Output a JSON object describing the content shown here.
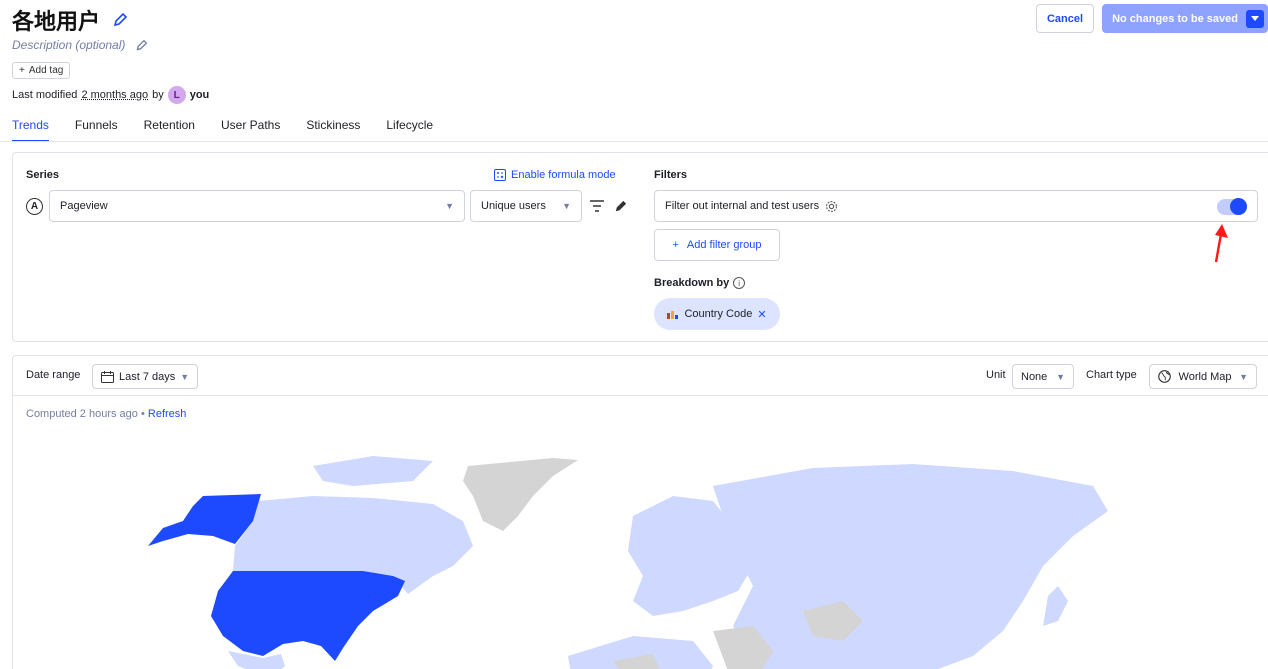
{
  "header": {
    "title": "各地用户",
    "description_placeholder": "Description (optional)",
    "add_tag_label": "Add tag",
    "modified_prefix": "Last modified",
    "modified_ago": "2 months ago",
    "modified_by": "by",
    "avatar_letter": "L",
    "author": "you"
  },
  "actions": {
    "cancel_label": "Cancel",
    "save_label": "No changes to be saved"
  },
  "tabs": [
    {
      "label": "Trends",
      "active": true
    },
    {
      "label": "Funnels"
    },
    {
      "label": "Retention"
    },
    {
      "label": "User Paths"
    },
    {
      "label": "Stickiness"
    },
    {
      "label": "Lifecycle"
    }
  ],
  "series": {
    "title": "Series",
    "formula_label": "Enable formula mode",
    "letter": "A",
    "event": "Pageview",
    "math": "Unique users"
  },
  "filters": {
    "title": "Filters",
    "internal_filter_label": "Filter out internal and test users",
    "internal_filter_enabled": true,
    "add_group_label": "Add filter group",
    "breakdown_title": "Breakdown by",
    "breakdown_value": "Country Code"
  },
  "chart_controls": {
    "date_range_label": "Date range",
    "date_range_value": "Last 7 days",
    "unit_label": "Unit",
    "unit_value": "None",
    "chart_type_label": "Chart type",
    "chart_type_value": "World Map",
    "computed_text": "Computed 2 hours ago",
    "refresh_label": "Refresh"
  },
  "colors": {
    "accent": "#1d4aff",
    "map_highlight": "#1d4aff",
    "map_low": "#cfd8ff",
    "map_none": "#d4d4d4"
  },
  "chart_data": {
    "type": "heatmap",
    "highlighted_regions": [
      "US"
    ]
  }
}
